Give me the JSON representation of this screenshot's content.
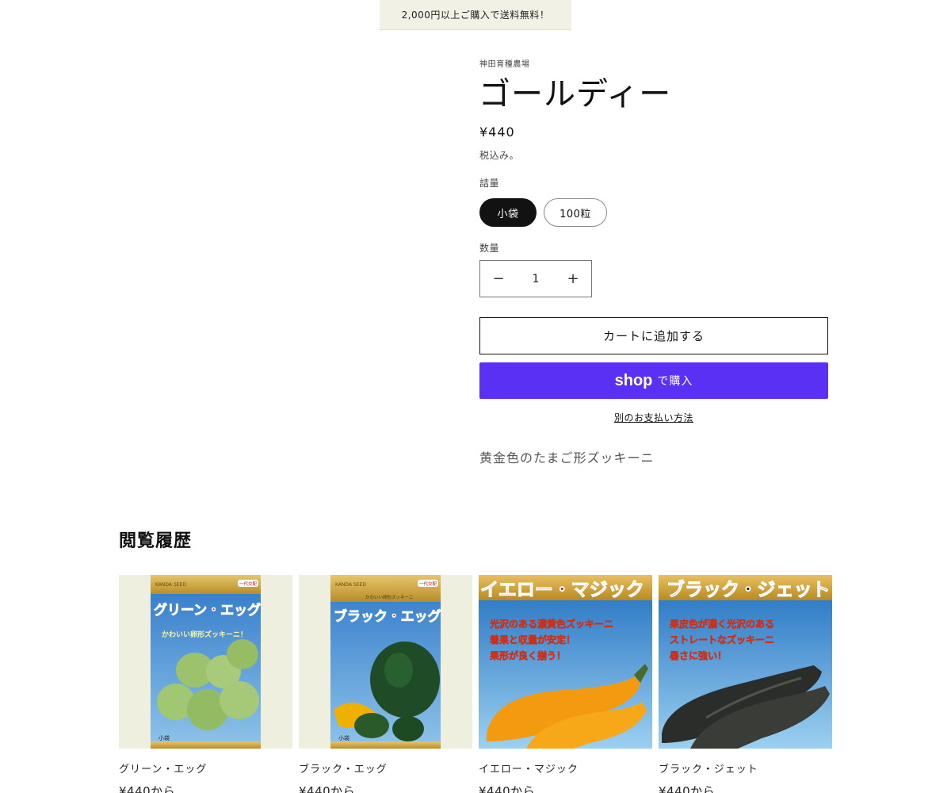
{
  "announcement": "2,000円以上ご購入で送料無料！",
  "product": {
    "vendor": "神田育種農場",
    "title": "ゴールディー",
    "price": "¥440",
    "tax_note": "税込み。",
    "option_label": "詰量",
    "options": [
      "小袋",
      "100粒"
    ],
    "selected_option": "小袋",
    "quantity_label": "数量",
    "quantity_value": "1",
    "minus_symbol": "−",
    "plus_symbol": "+",
    "add_to_cart": "カートに追加する",
    "shop_logo": "shop",
    "shop_buy": "で購入",
    "more_payment": "別のお支払い方法",
    "description": "黄金色のたまご形ズッキーニ"
  },
  "history": {
    "title": "閲覧履歴",
    "items": [
      {
        "name": "グリーン・エッグ",
        "price": "¥440から",
        "packet_brand": "KANDA SEED",
        "packet_badge": "一代交配",
        "packet_title": "グリーン・エッグ",
        "packet_sub": "かわいい卵形ズッキーニ！",
        "packet_size": "小袋"
      },
      {
        "name": "ブラック・エッグ",
        "price": "¥440から",
        "packet_brand": "KANDA SEED",
        "packet_badge": "一代交配",
        "packet_title": "ブラック・エッグ",
        "packet_sub": "かわいい卵形ズッキーニ",
        "packet_size": "小袋"
      },
      {
        "name": "イエロー・マジック",
        "price": "¥440から",
        "packet_title": "イエロー・マジック",
        "packet_lines": [
          "光沢のある濃黄色ズッキーニ",
          "着果と収量が安定！",
          "果形が良く揃う！"
        ]
      },
      {
        "name": "ブラック・ジェット",
        "price": "¥440から",
        "packet_title": "ブラック・ジェット",
        "packet_lines": [
          "果皮色が濃く光沢のある",
          "ストレートなズッキーニ",
          "暑さに強い！"
        ]
      }
    ]
  },
  "colors": {
    "shop_purple": "#5a31f4",
    "announcement_bg": "#f1f1e5",
    "card_bg": "#efefe0"
  }
}
